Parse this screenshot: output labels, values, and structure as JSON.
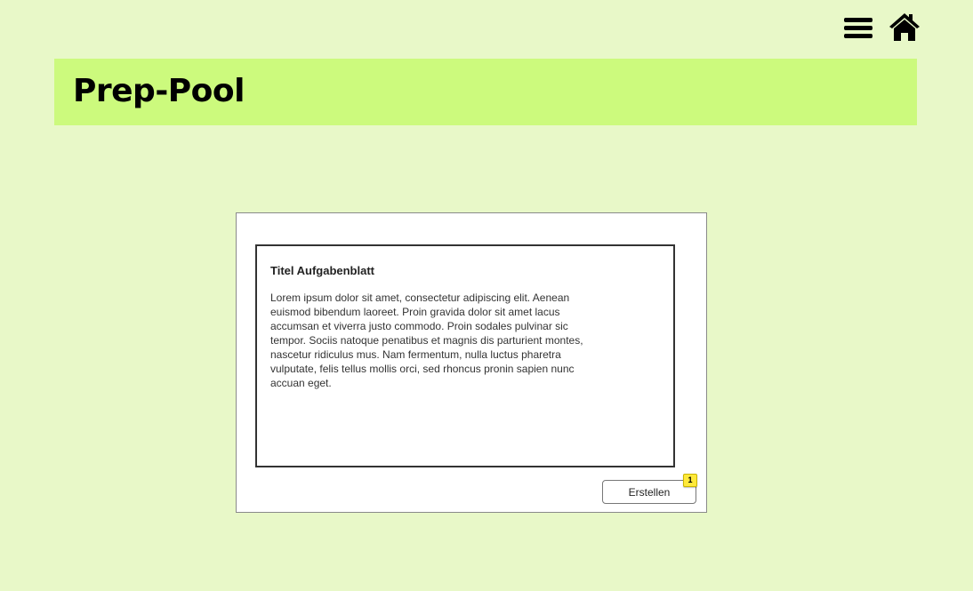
{
  "icons": {
    "menu": "hamburger-menu-icon",
    "home": "home-icon"
  },
  "header": {
    "title": "Prep-Pool"
  },
  "sheet": {
    "title": "Titel Aufgabenblatt",
    "body": "Lorem ipsum dolor sit amet, consectetur adipiscing elit. Aenean euismod bibendum laoreet. Proin gravida dolor sit amet lacus accumsan et viverra justo commodo. Proin sodales pulvinar sic tempor. Sociis natoque penatibus et magnis dis parturient montes, nascetur ridiculus mus. Nam fermentum, nulla luctus pharetra vulputate, felis tellus mollis orci, sed rhoncus pronin sapien nunc accuan eget."
  },
  "actions": {
    "create_label": "Erstellen",
    "badge": "1"
  },
  "colors": {
    "background": "#e8f8c8",
    "banner": "#ccfa7d",
    "badge": "#ffe93a"
  }
}
